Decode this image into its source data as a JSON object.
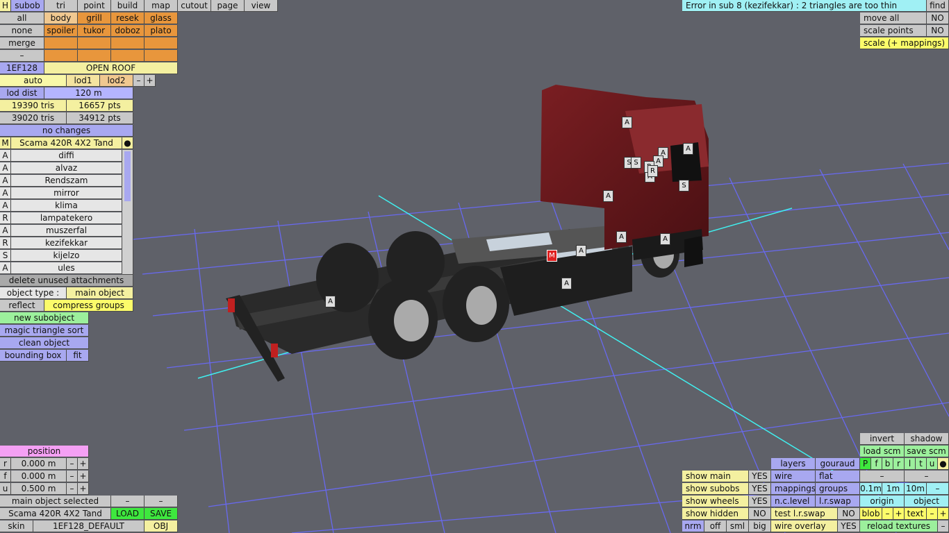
{
  "topbar": {
    "h": "H",
    "tabs": [
      "subob",
      "tri",
      "point",
      "build",
      "map",
      "cutout",
      "page",
      "view"
    ]
  },
  "error": {
    "message": "Error in sub 8 (kezifekkar) : 2 triangles are too thin",
    "find": "find"
  },
  "right_top": {
    "move_all": "move all",
    "move_all_val": "NO",
    "scale_points": "scale points",
    "scale_points_val": "NO",
    "scale_mappings": "scale (+ mappings)"
  },
  "groups": {
    "row1": [
      "all",
      "body",
      "grill",
      "resek",
      "glass"
    ],
    "row2": [
      "none",
      "spoiler",
      "tukor",
      "doboz",
      "plato"
    ],
    "row3": [
      "merge",
      "",
      "",
      "",
      ""
    ],
    "row4": [
      "–",
      "",
      "",
      "",
      ""
    ]
  },
  "texture": {
    "id": "1EF128",
    "name": "OPEN ROOF"
  },
  "lod": {
    "auto": "auto",
    "lod1": "lod1",
    "lod2": "lod2",
    "minus": "–",
    "plus": "+",
    "dist_label": "lod dist",
    "dist_val": "120 m"
  },
  "stats": {
    "tris1": "19390 tris",
    "pts1": "16657 pts",
    "tris2": "39020 tris",
    "pts2": "34912 pts",
    "changes": "no changes"
  },
  "model": {
    "m": "M",
    "name": "Scama 420R 4X2 Tand",
    "dot": "●"
  },
  "attachments": [
    {
      "t": "A",
      "name": "diffi"
    },
    {
      "t": "A",
      "name": "alvaz"
    },
    {
      "t": "A",
      "name": "Rendszam"
    },
    {
      "t": "A",
      "name": "mirror"
    },
    {
      "t": "A",
      "name": "klima"
    },
    {
      "t": "R",
      "name": "lampatekero"
    },
    {
      "t": "A",
      "name": "muszerfal"
    },
    {
      "t": "R",
      "name": "kezifekkar"
    },
    {
      "t": "S",
      "name": "kijelzo"
    },
    {
      "t": "A",
      "name": "ules"
    }
  ],
  "actions": {
    "delete_unused": "delete unused attachments",
    "object_type_label": "object type :",
    "object_type_val": "main object",
    "reflect": "reflect",
    "compress": "compress groups",
    "new_subobject": "new subobject",
    "magic_sort": "magic triangle sort",
    "clean_object": "clean object",
    "bounding_box": "bounding box",
    "fit": "fit"
  },
  "position": {
    "title": "position",
    "rows": [
      {
        "axis": "r",
        "val": "0.000 m"
      },
      {
        "axis": "f",
        "val": "0.000 m"
      },
      {
        "axis": "u",
        "val": "0.500 m"
      }
    ],
    "minus": "–",
    "plus": "+"
  },
  "bottom_left": {
    "selected": "main object selected",
    "dash": "–",
    "name": "Scama 420R 4X2 Tand",
    "load": "LOAD",
    "save": "SAVE",
    "skin": "skin",
    "skin_val": "1EF128_DEFAULT",
    "obj": "OBJ"
  },
  "bottom_right": {
    "invert": "invert",
    "shadow": "shadow",
    "load_scm": "load scm",
    "save_scm": "save scm",
    "layers": "layers",
    "gouraud": "gouraud",
    "pflags": [
      "P",
      "f",
      "b",
      "r",
      "l",
      "t",
      "u",
      "●"
    ],
    "show_main": "show main",
    "show_main_val": "YES",
    "wire": "wire",
    "flat": "flat",
    "show_subobs": "show subobs",
    "show_subobs_val": "YES",
    "mappings": "mappings",
    "groups": "groups",
    "d01": "0.1m",
    "d1": "1m",
    "d10": "10m",
    "show_wheels": "show wheels",
    "show_wheels_val": "YES",
    "nc_level": "n.c.level",
    "lr_swap": "l.r.swap",
    "origin": "origin",
    "object": "object",
    "show_hidden": "show hidden",
    "show_hidden_val": "NO",
    "test_lr_swap": "test l.r.swap",
    "test_lr_val": "NO",
    "blob": "blob",
    "text": "text",
    "nrm": "nrm",
    "off": "off",
    "sml": "sml",
    "big": "big",
    "wire_overlay": "wire overlay",
    "wire_overlay_val": "YES",
    "reload": "reload textures",
    "minus": "–",
    "plus": "+"
  },
  "markers": [
    "A",
    "A",
    "A",
    "A",
    "A",
    "A",
    "A",
    "A",
    "A",
    "A",
    "A",
    "A",
    "S",
    "S",
    "R",
    "R",
    "S",
    "M"
  ]
}
